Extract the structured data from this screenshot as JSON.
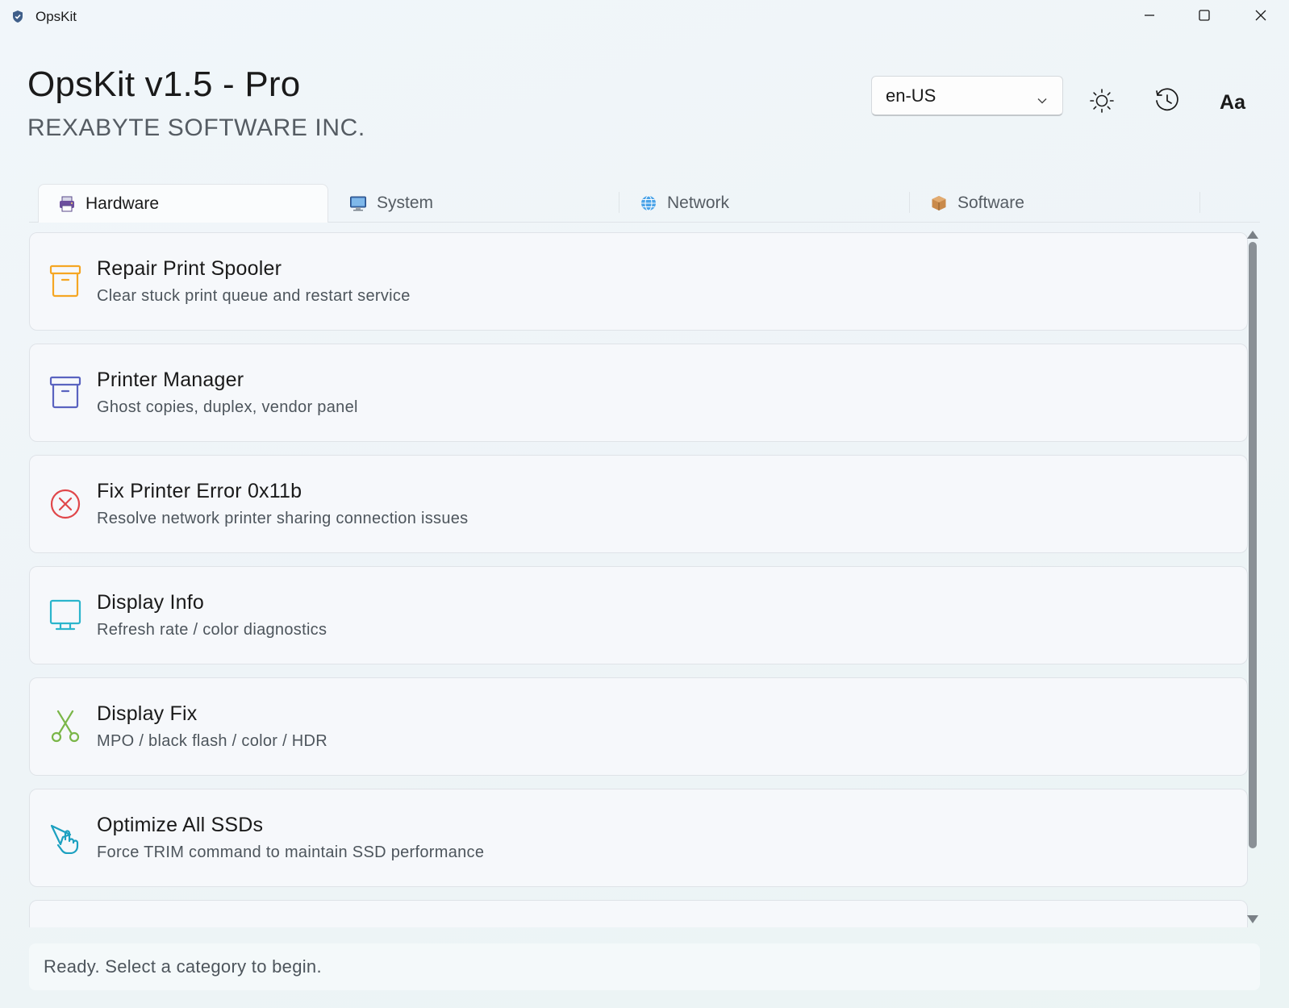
{
  "window": {
    "title": "OpsKit",
    "icons": {
      "app": "shield-icon",
      "minimize": "minimize-icon",
      "maximize": "maximize-icon",
      "close": "close-icon"
    }
  },
  "header": {
    "title": "OpsKit v1.5 - Pro",
    "company": "REXABYTE SOFTWARE INC.",
    "language": {
      "selected": "en-US",
      "icon": "chevron-down-icon"
    },
    "actions": [
      {
        "name": "theme",
        "icon": "sun-icon"
      },
      {
        "name": "history",
        "icon": "history-icon"
      },
      {
        "name": "font-size",
        "label": "Aa"
      }
    ]
  },
  "tabs": [
    {
      "label": "Hardware",
      "icon": "printer-icon",
      "active": true
    },
    {
      "label": "System",
      "icon": "monitor-icon",
      "active": false
    },
    {
      "label": "Network",
      "icon": "globe-icon",
      "active": false
    },
    {
      "label": "Software",
      "icon": "package-icon",
      "active": false
    }
  ],
  "tools": [
    {
      "title": "Repair Print Spooler",
      "subtitle": "Clear stuck print queue and restart service",
      "icon": "archive-box-icon",
      "color": "#f5a623"
    },
    {
      "title": "Printer Manager",
      "subtitle": "Ghost copies, duplex, vendor panel",
      "icon": "archive-box-icon",
      "color": "#5a63c0"
    },
    {
      "title": "Fix Printer Error 0x11b",
      "subtitle": "Resolve network printer sharing connection issues",
      "icon": "error-circle-icon",
      "color": "#e0474a"
    },
    {
      "title": "Display Info",
      "subtitle": "Refresh rate / color diagnostics",
      "icon": "monitor-icon",
      "color": "#2bb5cc"
    },
    {
      "title": "Display Fix",
      "subtitle": "MPO / black flash / color / HDR",
      "icon": "scissors-icon",
      "color": "#7ab648"
    },
    {
      "title": "Optimize All SSDs",
      "subtitle": "Force TRIM command to maintain SSD performance",
      "icon": "pointer-hand-icon",
      "color": "#1ba0c0"
    },
    {
      "title": "",
      "subtitle": "",
      "icon": "",
      "color": ""
    }
  ],
  "status": {
    "text": "Ready. Select a category to begin."
  }
}
